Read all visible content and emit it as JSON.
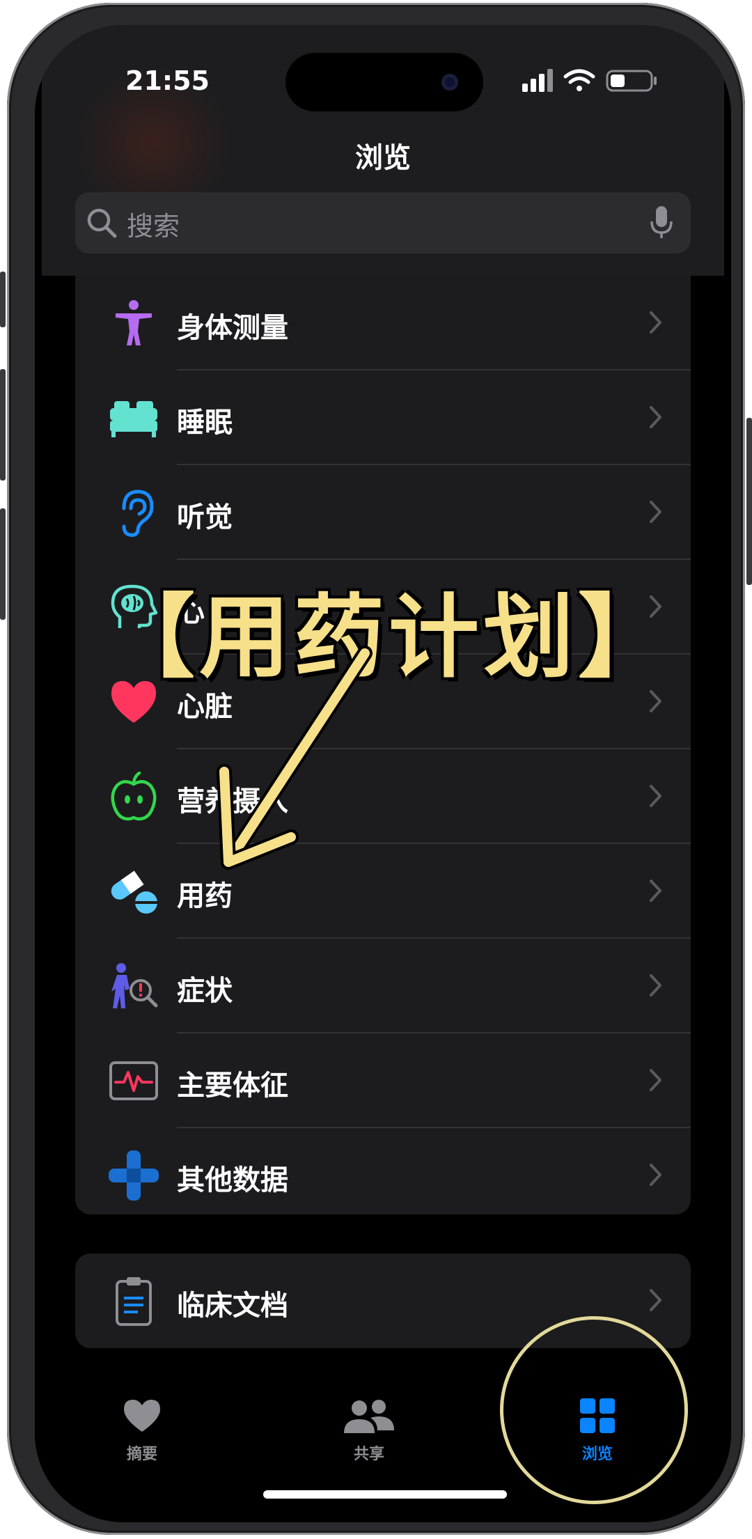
{
  "status_bar": {
    "time": "21:55"
  },
  "nav": {
    "title": "浏览"
  },
  "search": {
    "placeholder": "搜索"
  },
  "categories": [
    {
      "label": "身体测量",
      "icon": "figure-icon",
      "color": "#b56cf0"
    },
    {
      "label": "睡眠",
      "icon": "bed-icon",
      "color": "#63e2d0"
    },
    {
      "label": "听觉",
      "icon": "ear-icon",
      "color": "#1a8cff"
    },
    {
      "label": "心",
      "icon": "brain-head-icon",
      "color": "#63e2d0"
    },
    {
      "label": "心脏",
      "icon": "heart-icon",
      "color": "#ff375f"
    },
    {
      "label": "营养摄入",
      "icon": "apple-icon",
      "color": "#32d74b"
    },
    {
      "label": "用药",
      "icon": "pills-icon",
      "color": "#5ac8fa"
    },
    {
      "label": "症状",
      "icon": "symptoms-icon",
      "color": "#5e5ce6"
    },
    {
      "label": "主要体征",
      "icon": "vitals-icon",
      "color": "#ff375f"
    },
    {
      "label": "其他数据",
      "icon": "plus-icon",
      "color": "#1a6fd0"
    }
  ],
  "clinical": {
    "label": "临床文档",
    "icon": "clipboard-icon"
  },
  "tabs": [
    {
      "label": "摘要",
      "icon": "heart-tab-icon",
      "active": false
    },
    {
      "label": "共享",
      "icon": "people-icon",
      "active": false
    },
    {
      "label": "浏览",
      "icon": "grid-icon",
      "active": true
    }
  ],
  "overlay": {
    "text": "【用药计划】"
  },
  "colors": {
    "accent": "#0a84ff",
    "overlay": "#f7e08a"
  }
}
